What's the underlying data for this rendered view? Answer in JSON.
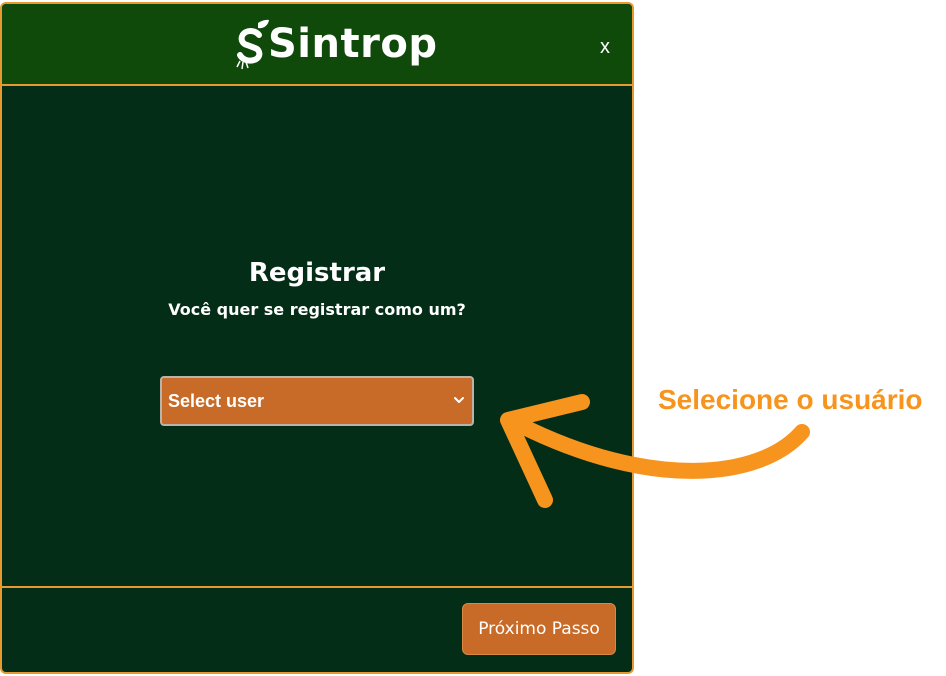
{
  "header": {
    "logo_text": "Sintrop",
    "close_label": "x"
  },
  "body": {
    "title": "Registrar",
    "subtitle": "Você quer se registrar como um?",
    "user_select": {
      "selected": "Select user"
    }
  },
  "footer": {
    "next_label": "Próximo Passo"
  },
  "annotation": {
    "text": "Selecione o usuário",
    "color": "#f7941d"
  },
  "colors": {
    "modal_bg": "#042d17",
    "header_bg": "#0f4a0b",
    "border": "#e79a2f",
    "accent_button": "#c86b28"
  },
  "icons": {
    "logo": "sprout-s-logo-icon",
    "close": "close-icon",
    "select_chevron": "chevron-down-icon",
    "annotation": "curved-arrow-icon"
  }
}
